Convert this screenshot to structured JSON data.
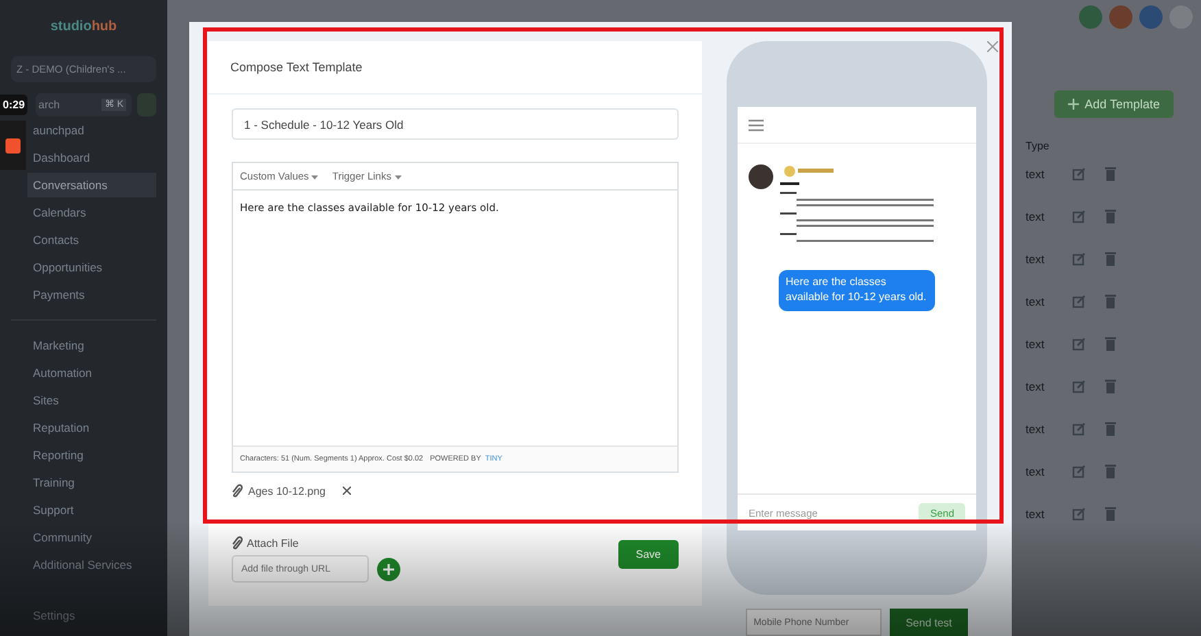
{
  "recording": {
    "timer": "0:29"
  },
  "sidebar": {
    "logo": [
      "studio",
      "hub"
    ],
    "account": "Z - DEMO (Children's ...",
    "search": {
      "placeholder": "arch",
      "shortcut": "⌘ K"
    },
    "items": [
      {
        "label": "aunchpad",
        "selected": false
      },
      {
        "label": "Dashboard",
        "selected": false
      },
      {
        "label": "Conversations",
        "selected": true
      },
      {
        "label": "Calendars",
        "selected": false
      },
      {
        "label": "Contacts",
        "selected": false
      },
      {
        "label": "Opportunities",
        "selected": false
      },
      {
        "label": "Payments",
        "selected": false
      }
    ],
    "more_items": [
      {
        "label": "Marketing"
      },
      {
        "label": "Automation"
      },
      {
        "label": "Sites"
      },
      {
        "label": "Reputation"
      },
      {
        "label": "Reporting"
      },
      {
        "label": "Training"
      },
      {
        "label": "Support"
      },
      {
        "label": "Community"
      },
      {
        "label": "Additional Services"
      }
    ],
    "settings": "Settings"
  },
  "page": {
    "add_button": "Add Template",
    "type_header": "Type",
    "rows": [
      "text",
      "text",
      "text",
      "text",
      "text",
      "text",
      "text",
      "text",
      "text"
    ]
  },
  "modal": {
    "title": "Compose Text Template",
    "name": "1 - Schedule - 10-12 Years Old",
    "toolbar": [
      "Custom Values",
      "Trigger Links"
    ],
    "body": "Here are the classes available for 10-12 years old.",
    "counter": "Characters: 51 (Num. Segments 1) Approx. Cost $0.02",
    "powered": [
      "POWERED BY",
      "TINY"
    ],
    "attachment": "Ages 10-12.png",
    "attach_label": "Attach File",
    "url_placeholder": "Add file through URL",
    "save": "Save"
  },
  "preview": {
    "bubble": "Here are the classes available for 10-12 years old.",
    "message_placeholder": "Enter message",
    "send": "Send",
    "phone_placeholder": "Mobile Phone Number",
    "send_test": "Send test"
  }
}
